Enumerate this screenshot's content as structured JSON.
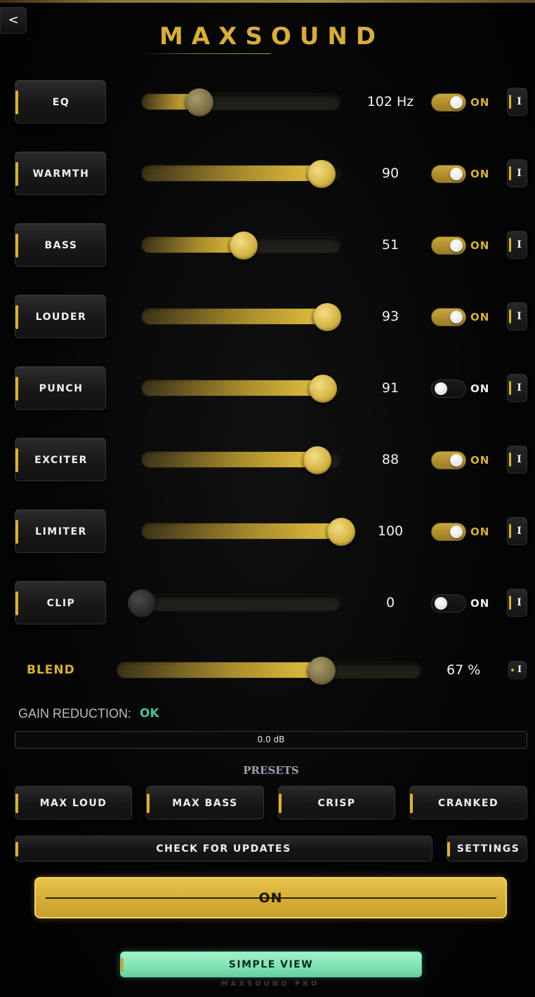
{
  "header": {
    "back_label": "<",
    "title": "MAXSOUND"
  },
  "controls": [
    {
      "label": "EQ",
      "value_text": "102 Hz",
      "level": 0.29,
      "toggle_on": true,
      "toggle_label": "ON",
      "info_label": "I"
    },
    {
      "label": "WARMTH",
      "value_text": "90",
      "level": 0.9,
      "toggle_on": true,
      "toggle_label": "ON",
      "info_label": "I"
    },
    {
      "label": "BASS",
      "value_text": "51",
      "level": 0.51,
      "toggle_on": true,
      "toggle_label": "ON",
      "info_label": "I"
    },
    {
      "label": "LOUDER",
      "value_text": "93",
      "level": 0.93,
      "toggle_on": true,
      "toggle_label": "ON",
      "info_label": "I"
    },
    {
      "label": "PUNCH",
      "value_text": "91",
      "level": 0.91,
      "toggle_on": false,
      "toggle_label": "ON",
      "info_label": "I"
    },
    {
      "label": "EXCITER",
      "value_text": "88",
      "level": 0.88,
      "toggle_on": true,
      "toggle_label": "ON",
      "info_label": "I"
    },
    {
      "label": "LIMITER",
      "value_text": "100",
      "level": 1.0,
      "toggle_on": true,
      "toggle_label": "ON",
      "info_label": "I"
    },
    {
      "label": "CLIP",
      "value_text": "0",
      "level": 0.0,
      "toggle_on": false,
      "toggle_label": "ON",
      "info_label": "I"
    }
  ],
  "blend": {
    "label": "BLEND",
    "value_text": "67 %",
    "level": 0.67,
    "info_label": "I"
  },
  "gain_reduction": {
    "label": "GAIN REDUCTION:",
    "status": "OK",
    "meter_text": "0.0 dB"
  },
  "presets": {
    "title": "PRESETS",
    "items": [
      "MAX LOUD",
      "MAX BASS",
      "CRISP",
      "CRANKED"
    ]
  },
  "actions": {
    "check_updates": "CHECK FOR UPDATES",
    "settings": "SETTINGS",
    "power": "ON",
    "simple_view": "SIMPLE VIEW"
  },
  "footer": "MAXSOUND PRO",
  "colors": {
    "accent_gold": "#d8b03a",
    "status_ok": "#43c79a",
    "simple_view_green": "#8aeabd"
  }
}
